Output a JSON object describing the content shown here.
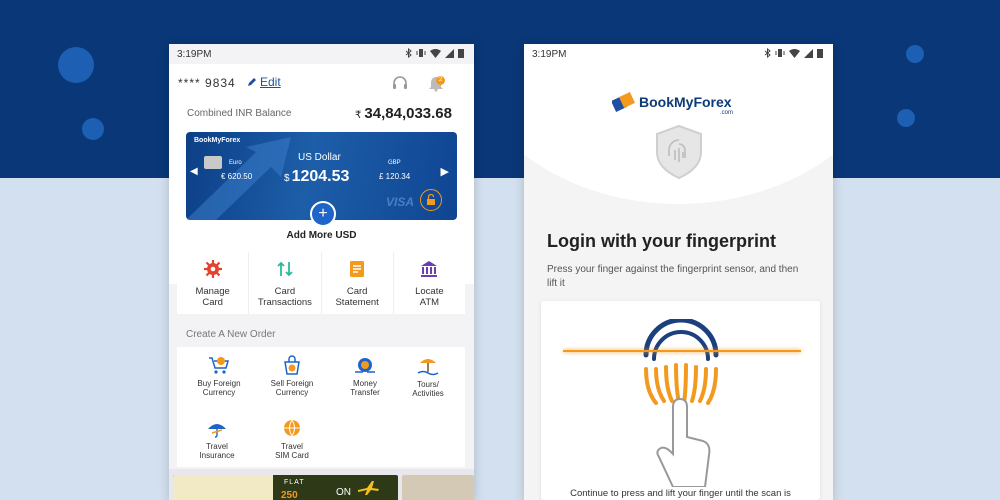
{
  "colors": {
    "navy": "#0a3777",
    "accent": "#f39a1e",
    "blue": "#1f64c8",
    "light_bg": "#d3e0ef"
  },
  "left_phone": {
    "status": {
      "time": "3:19PM"
    },
    "header": {
      "account": "**** 9834",
      "edit": "Edit",
      "notification_count": "2"
    },
    "balance": {
      "label": "Combined INR Balance",
      "currency_symbol": "₹",
      "value": "34,84,033.68"
    },
    "card": {
      "brand": "BookMyForex",
      "left": {
        "currency": "Euro",
        "amount": "€ 620.50"
      },
      "center": {
        "currency": "US Dollar",
        "symbol": "$",
        "amount": "1204.53"
      },
      "right": {
        "currency": "GBP",
        "amount": "£ 120.34"
      },
      "network": "VISA"
    },
    "add_more": "Add More USD",
    "quick_actions": [
      {
        "line1": "Manage",
        "line2": "Card",
        "icon": "gear-icon"
      },
      {
        "line1": "Card",
        "line2": "Transactions",
        "icon": "transfer-arrows-icon"
      },
      {
        "line1": "Card",
        "line2": "Statement",
        "icon": "statement-icon"
      },
      {
        "line1": "Locate",
        "line2": "ATM",
        "icon": "bank-icon"
      }
    ],
    "create_order_label": "Create A New Order",
    "orders": [
      {
        "line1": "Buy Foreign",
        "line2": "Currency",
        "icon": "cart-currency-icon"
      },
      {
        "line1": "Sell Foreign",
        "line2": "Currency",
        "icon": "bag-currency-icon"
      },
      {
        "line1": "Money",
        "line2": "Transfer",
        "icon": "money-transfer-icon"
      },
      {
        "line1": "Tours/",
        "line2": "Activities",
        "icon": "beach-icon"
      },
      {
        "line1": "Travel",
        "line2": "Insurance",
        "icon": "umbrella-plane-icon"
      },
      {
        "line1": "Travel",
        "line2": "SIM Card",
        "icon": "sim-card-icon"
      }
    ],
    "banner": {
      "flat": "FLAT",
      "amount": "250",
      "on": "ON"
    }
  },
  "right_phone": {
    "status": {
      "time": "3:19PM"
    },
    "logo": {
      "name": "BookMyForex",
      "domain": ".com"
    },
    "title": "Login with your fingerprint",
    "description": "Press your finger against the fingerprint sensor, and then lift it",
    "continue_text": "Continue to press and lift your finger until the scan is"
  }
}
